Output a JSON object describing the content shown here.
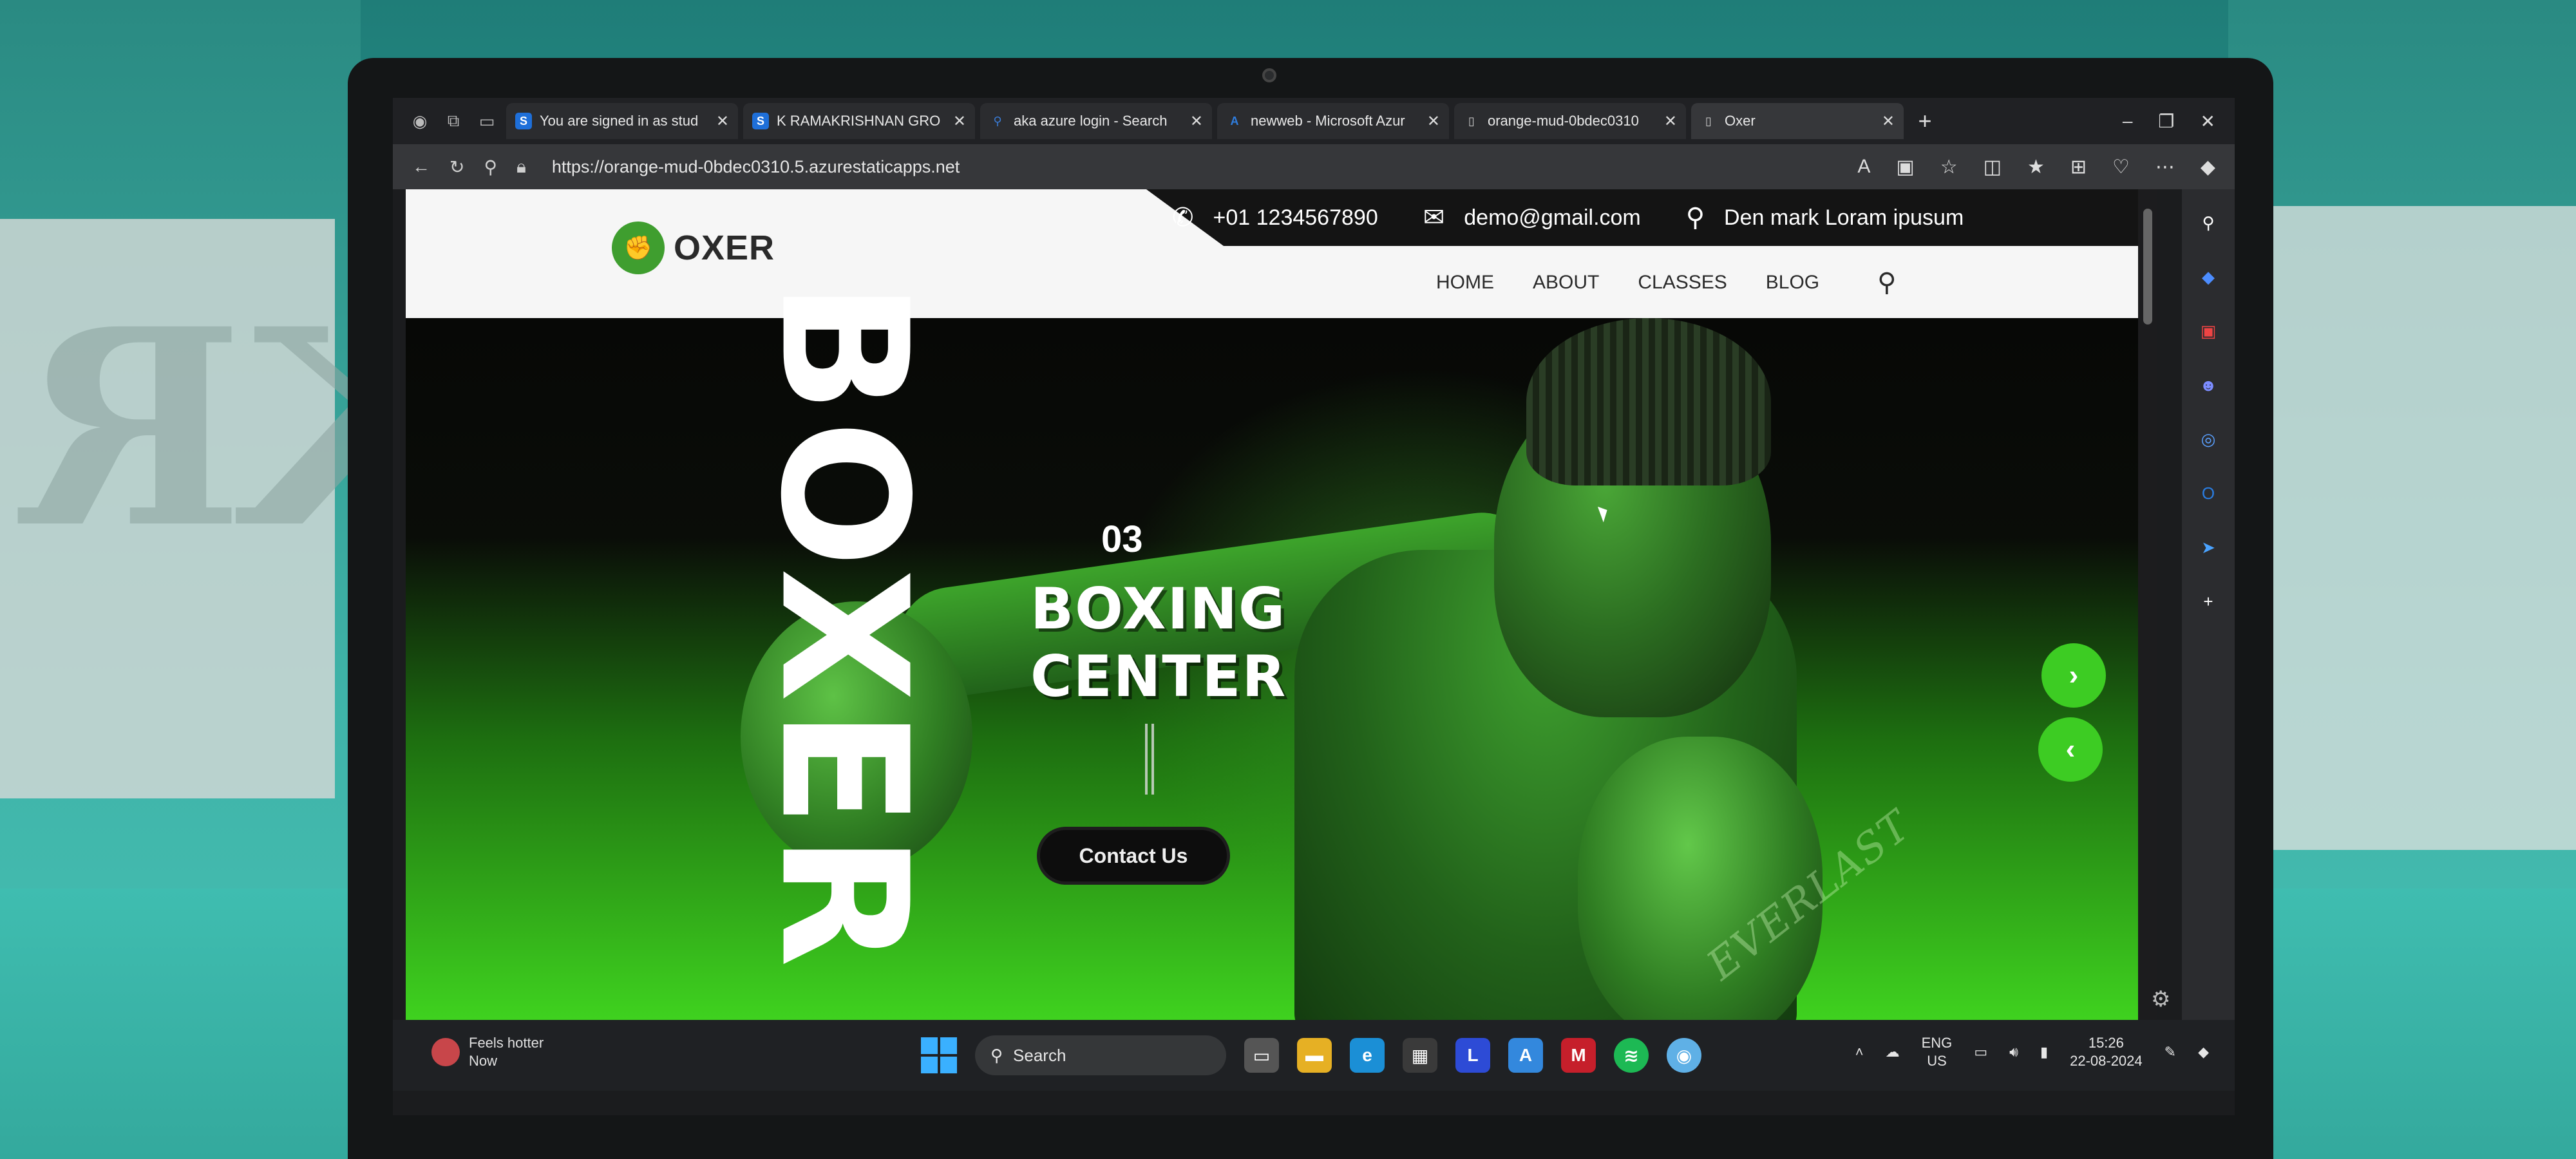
{
  "browser": {
    "tabs": [
      {
        "title": "You are signed in as stud",
        "favicon": "S",
        "color": "#1e6fd9"
      },
      {
        "title": "K RAMAKRISHNAN GRO",
        "favicon": "S",
        "color": "#1e6fd9"
      },
      {
        "title": "aka azure login - Search",
        "favicon": "search-icon",
        "color": "#3a7bd5"
      },
      {
        "title": "newweb - Microsoft Azur",
        "favicon": "A",
        "color": "#2f7ee0"
      },
      {
        "title": "orange-mud-0bdec0310",
        "favicon": "page-icon",
        "color": "#777777"
      },
      {
        "title": "Oxer",
        "favicon": "page-icon",
        "color": "#777777",
        "active": true
      }
    ],
    "url": "https://orange-mud-0bdec0310.5.azurestaticapps.net"
  },
  "site": {
    "logo_text": "OXER",
    "phone": "+01 1234567890",
    "email": "demo@gmail.com",
    "address": "Den mark Loram ipusum",
    "nav": [
      "HOME",
      "ABOUT",
      "CLASSES",
      "BLOG"
    ],
    "hero": {
      "vertical_text": "BOXER",
      "number": "03",
      "title_line1": "BOXING",
      "title_line2": "CENTER",
      "cta": "Contact Us",
      "glove_brand": "EVERLAST"
    },
    "accent_color": "#3dcc23"
  },
  "taskbar": {
    "weather_title": "Feels hotter",
    "weather_sub": "Now",
    "search_label": "Search",
    "lang_top": "ENG",
    "lang_bottom": "US",
    "time": "15:26",
    "date": "22-08-2024"
  }
}
